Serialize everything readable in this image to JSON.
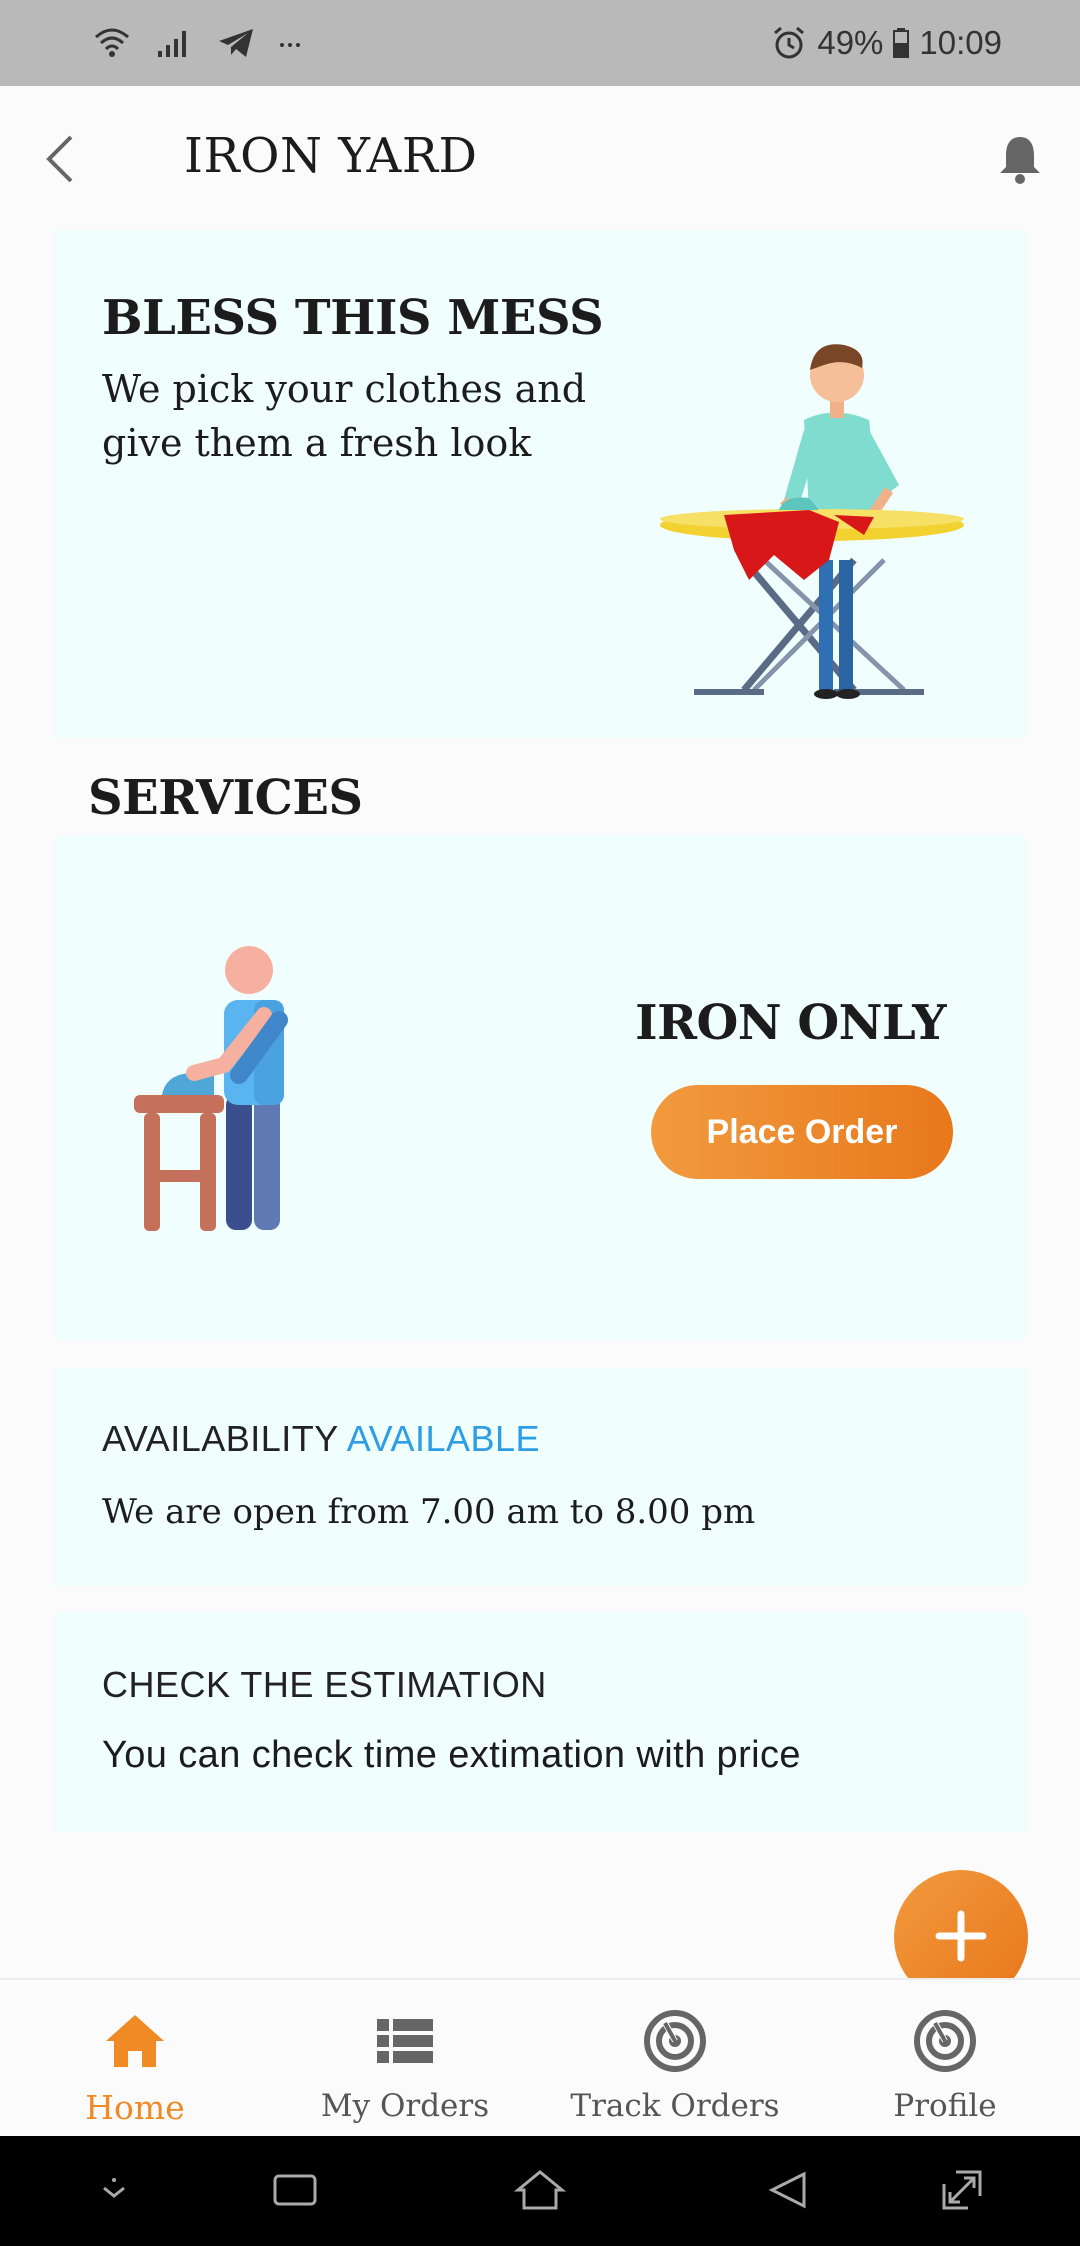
{
  "status_bar": {
    "battery": "49%",
    "time": "10:09",
    "left_icons": [
      "wifi-icon",
      "signal-icon",
      "telegram-icon",
      "more-icon"
    ],
    "right_icons": [
      "alarm-icon",
      "battery-icon"
    ]
  },
  "app_bar": {
    "title": "IRON YARD",
    "back_icon": "chevron-left-icon",
    "notification_icon": "bell-icon"
  },
  "hero": {
    "title": "BLESS THIS MESS",
    "text": "We pick your clothes and give them a fresh look"
  },
  "services": {
    "section_title": "SERVICES",
    "items": [
      {
        "name": "IRON ONLY",
        "button_label": "Place Order"
      }
    ]
  },
  "availability": {
    "label": "AVAILABILITY",
    "status": "AVAILABLE",
    "text": "We are open from 7.00 am to 8.00 pm"
  },
  "estimation": {
    "label": "CHECK THE ESTIMATION",
    "text": "You can check time extimation with price"
  },
  "fab": {
    "icon": "plus-icon"
  },
  "bottom_nav": {
    "items": [
      {
        "label": "Home",
        "icon": "home-icon",
        "active": true
      },
      {
        "label": "My Orders",
        "icon": "list-icon",
        "active": false
      },
      {
        "label": "Track Orders",
        "icon": "radar-icon",
        "active": false
      },
      {
        "label": "Profile",
        "icon": "radar-icon",
        "active": false
      }
    ]
  },
  "colors": {
    "accent": "#f08a24",
    "available": "#2d9de6",
    "card_bg": "#f0fffe",
    "status_bar": "#b9b9b9"
  }
}
